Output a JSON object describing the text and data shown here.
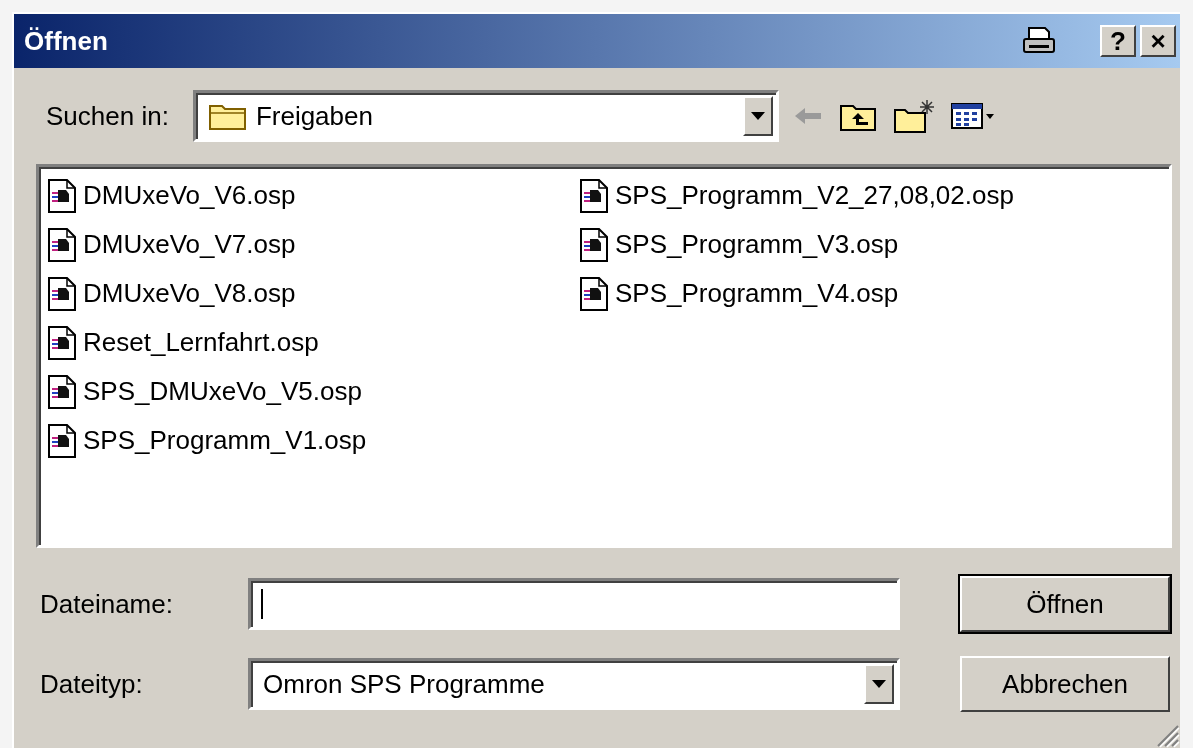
{
  "window": {
    "title": "Öffnen"
  },
  "title_buttons": [
    {
      "kind": "print"
    },
    {
      "kind": "help",
      "label": "?"
    },
    {
      "kind": "close",
      "label": "×"
    }
  ],
  "look_in": {
    "label": "Suchen in:",
    "value": "Freigaben"
  },
  "toolbar": [
    {
      "kind": "back",
      "disabled": true
    },
    {
      "kind": "up",
      "disabled": false
    },
    {
      "kind": "new-folder",
      "disabled": false
    },
    {
      "kind": "view-menu",
      "disabled": false
    }
  ],
  "files": [
    {
      "name": "DMUxeVo_V6.osp"
    },
    {
      "name": "DMUxeVo_V7.osp"
    },
    {
      "name": "DMUxeVo_V8.osp"
    },
    {
      "name": "Reset_Lernfahrt.osp"
    },
    {
      "name": "SPS_DMUxeVo_V5.osp"
    },
    {
      "name": "SPS_Programm_V1.osp"
    },
    {
      "name": "SPS_Programm_V2_27,08,02.osp"
    },
    {
      "name": "SPS_Programm_V3.osp"
    },
    {
      "name": "SPS_Programm_V4.osp"
    }
  ],
  "file_name": {
    "label": "Dateiname:"
  },
  "file_type": {
    "label": "Dateityp:",
    "value": "Omron SPS Programme"
  },
  "buttons": [
    {
      "kind": "default",
      "label": "Öffnen"
    },
    {
      "kind": "normal",
      "label": "Abbrechen"
    }
  ]
}
